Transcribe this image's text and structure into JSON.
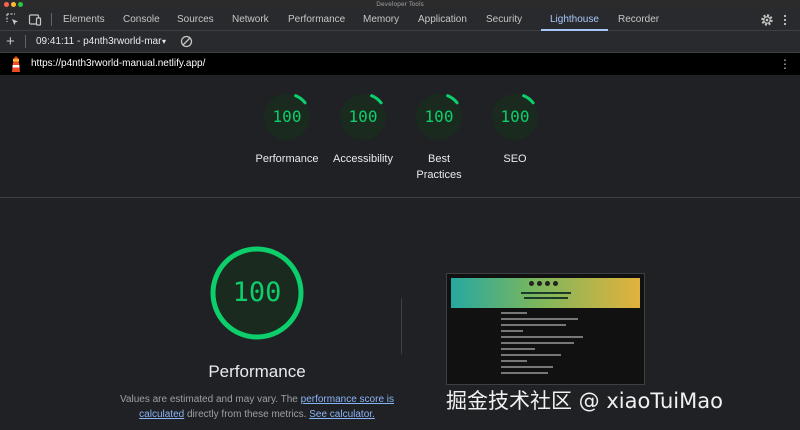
{
  "window": {
    "title": "Developer Tools",
    "traffic_lights": [
      "#ff5f57",
      "#febc2e",
      "#28c840"
    ]
  },
  "tabs": [
    "Elements",
    "Console",
    "Sources",
    "Network",
    "Performance",
    "Memory",
    "Application",
    "Security",
    "Lighthouse",
    "Recorder"
  ],
  "active_tab": "Lighthouse",
  "toolbar": {
    "report_label": "09:41:11 - p4nth3rworld-mar",
    "caret": "▾"
  },
  "urlbar": {
    "url": "https://p4nth3rworld-manual.netlify.app/"
  },
  "summary": {
    "gauges": [
      {
        "score": "100",
        "label": "Performance"
      },
      {
        "score": "100",
        "label": "Accessibility"
      },
      {
        "score": "100",
        "label": "Best Practices"
      },
      {
        "score": "100",
        "label": "SEO"
      }
    ]
  },
  "performance": {
    "score": "100",
    "title": "Performance",
    "desc_prefix": "Values are estimated and may vary. The ",
    "link1": "performance score is calculated",
    "desc_middle": " directly from these metrics. ",
    "link2": "See calculator."
  },
  "watermark": "掘金技术社区 @ xiaoTuiMao",
  "colors": {
    "pass_green": "#0cce6b",
    "accent_blue": "#a8c7fa",
    "link_blue": "#8ab4f8",
    "background": "#202124"
  }
}
